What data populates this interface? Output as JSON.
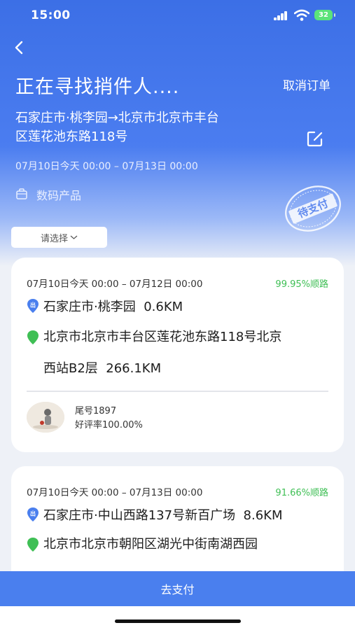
{
  "status": {
    "time": "15:00",
    "battery": "32"
  },
  "header": {
    "title": "正在寻找捎件人....",
    "cancel_label": "取消订单",
    "route_line1": "石家庄市·桃李园→北京市北京市丰台",
    "route_line2": "区莲花池东路118号",
    "time_range": "07月10日今天 00:00 – 07月13日 00:00",
    "category": "数码产品",
    "stamp_text": "待支付"
  },
  "filter": {
    "select_label": "请选择"
  },
  "cards": [
    {
      "time_range": "07月10日今天 00:00 – 07月12日 00:00",
      "match": "99.95%顺路",
      "origin": "石家庄市·桃李园",
      "origin_dist": "0.6KM",
      "dest_line1": "北京市北京市丰台区莲花池东路118号北京",
      "dest_line2": "西站B2层",
      "dest_dist": "266.1KM",
      "driver_tail": "尾号1897",
      "driver_rating": "好评率100.00%"
    },
    {
      "time_range": "07月10日今天 00:00 – 07月13日 00:00",
      "match": "91.66%顺路",
      "origin": "石家庄市·中山西路137号新百广场",
      "origin_dist": "8.6KM",
      "dest_line1": "北京市北京市朝阳区湖光中街南湖西园"
    }
  ],
  "footer": {
    "pay_label": "去支付"
  },
  "colors": {
    "primary": "#4a7fee",
    "match_green": "#3fbf55",
    "dest_pin": "#3fbf55",
    "origin_pin": "#4a7fee"
  }
}
